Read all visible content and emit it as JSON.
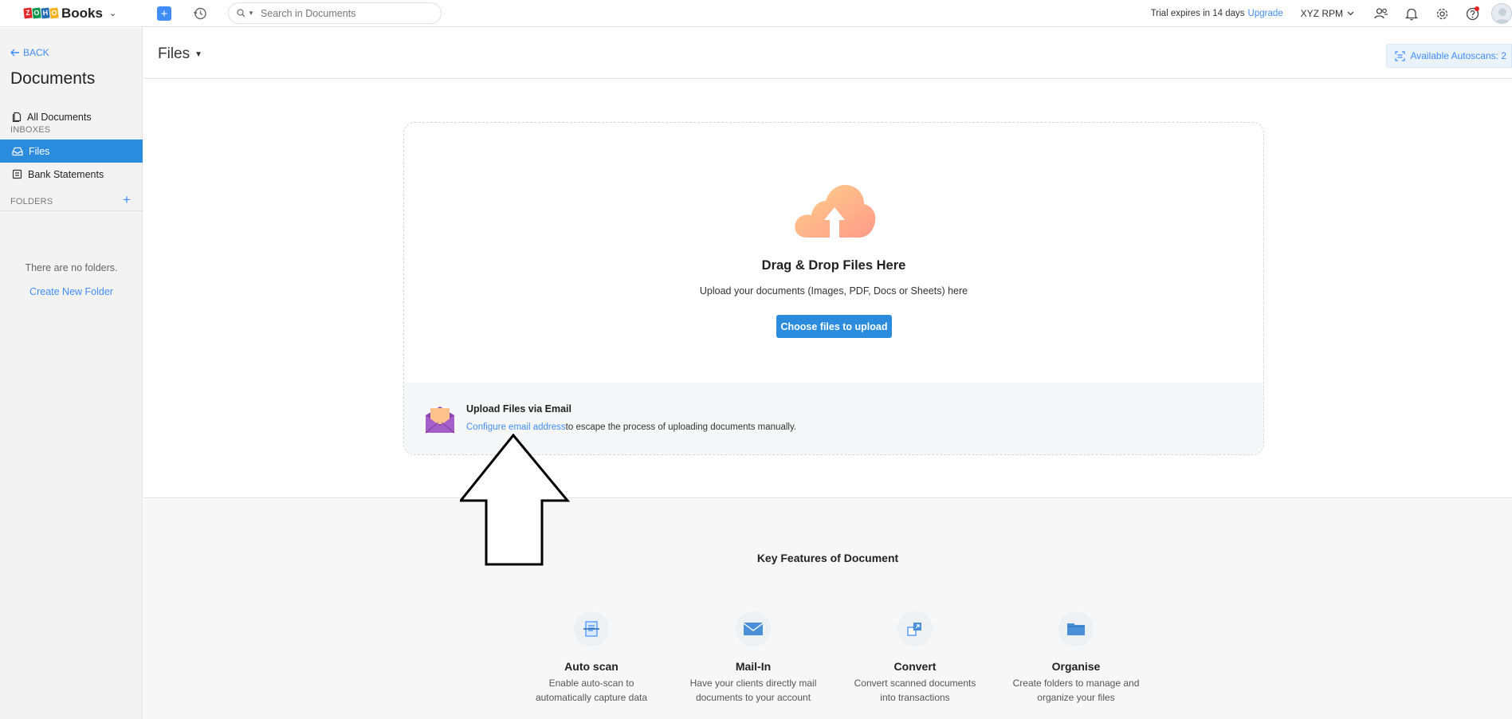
{
  "topbar": {
    "brand": "Books",
    "search_placeholder": "Search in Documents",
    "trial_text": "Trial expires in 14 days",
    "upgrade_label": "Upgrade",
    "org_name": "XYZ RPM"
  },
  "sidebar": {
    "back_label": "BACK",
    "title": "Documents",
    "all_documents": "All Documents",
    "inboxes_label": "INBOXES",
    "inbox_items": [
      {
        "label": "Files",
        "active": true
      },
      {
        "label": "Bank Statements",
        "active": false
      }
    ],
    "folders_label": "FOLDERS",
    "no_folders": "There are no folders.",
    "create_folder": "Create New Folder"
  },
  "header": {
    "title": "Files",
    "autoscan": "Available Autoscans: 2"
  },
  "dropzone": {
    "title": "Drag & Drop Files Here",
    "subtitle": "Upload your documents (Images, PDF, Docs or Sheets) here",
    "button": "Choose files to upload"
  },
  "email": {
    "title": "Upload Files via Email",
    "link": "Configure email address",
    "rest": "to escape the process of uploading documents manually."
  },
  "features": {
    "title": "Key Features of Document",
    "items": [
      {
        "title": "Auto scan",
        "desc": "Enable auto-scan to automatically capture data",
        "icon": "scan-icon"
      },
      {
        "title": "Mail-In",
        "desc": "Have your clients directly mail documents to your account",
        "icon": "mail-icon"
      },
      {
        "title": "Convert",
        "desc": "Convert scanned documents into transactions",
        "icon": "convert-icon"
      },
      {
        "title": "Organise",
        "desc": "Create folders to manage and organize your files",
        "icon": "folder-icon"
      }
    ]
  },
  "colors": {
    "accent": "#408dfb",
    "active_nav": "#2b8bdd",
    "cloud": "#ffb27a"
  }
}
